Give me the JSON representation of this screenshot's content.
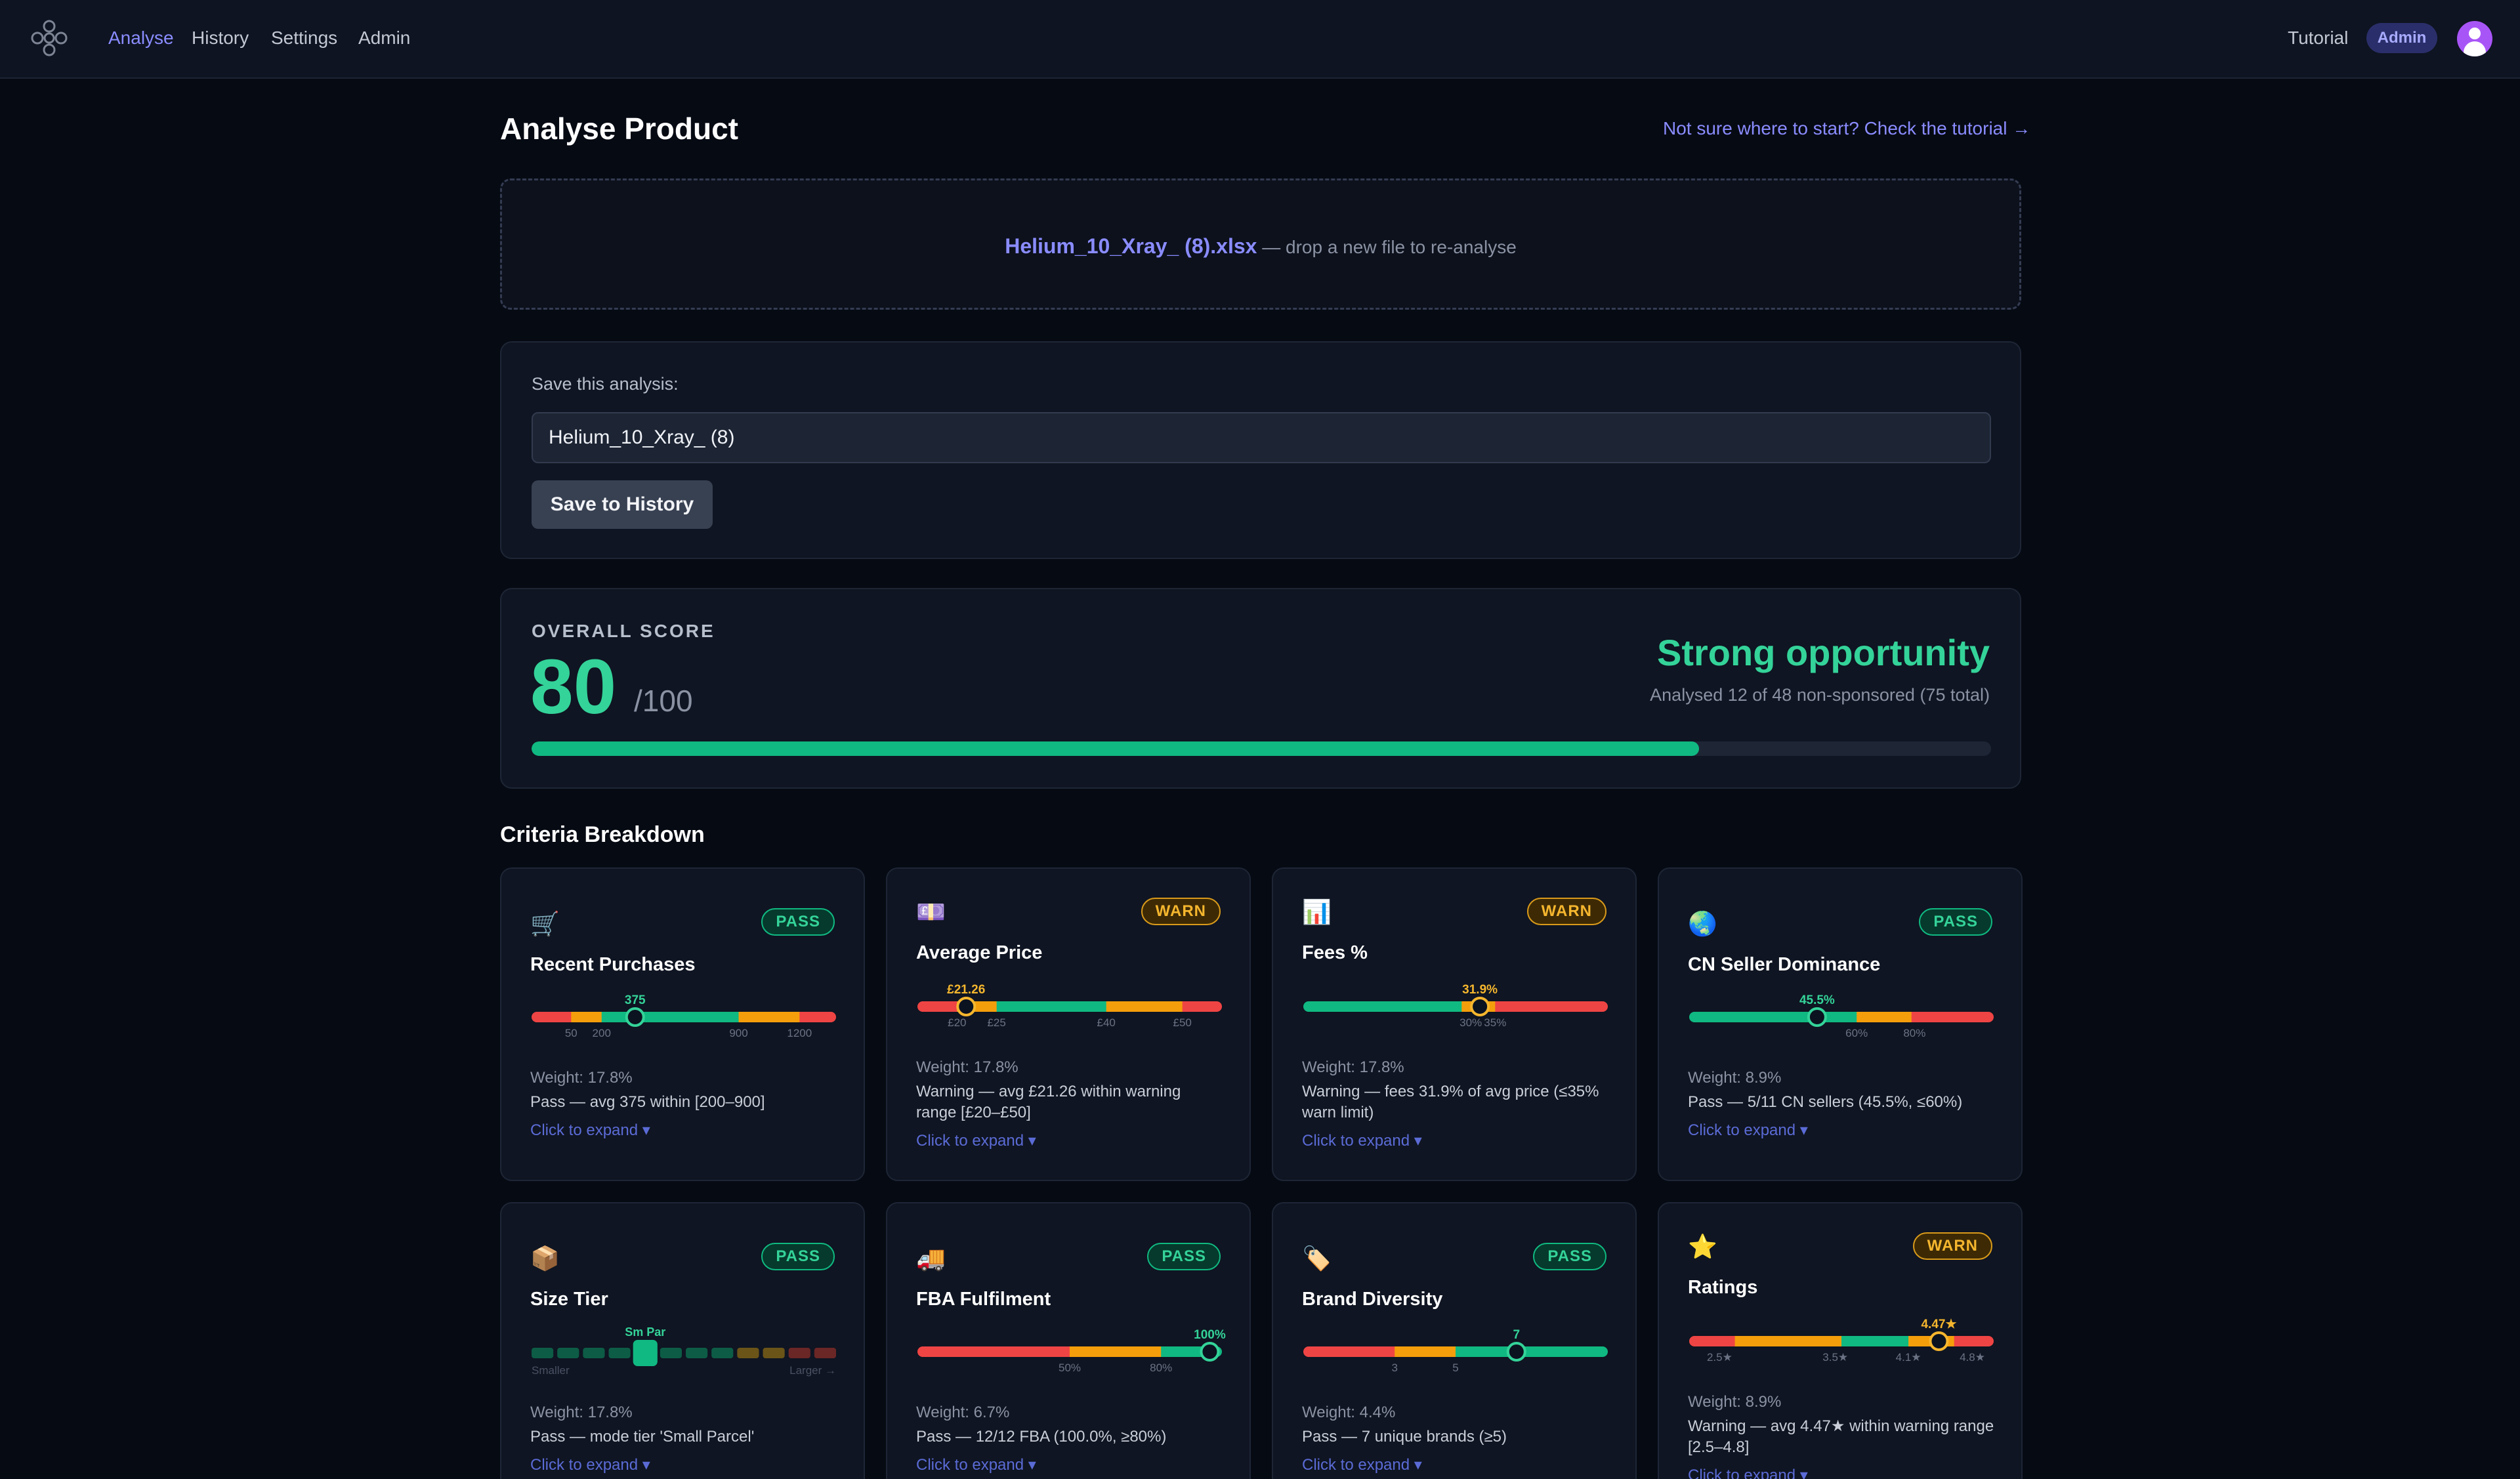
{
  "nav": {
    "links": [
      "Analyse",
      "History",
      "Settings",
      "Admin"
    ],
    "tutorial": "Tutorial",
    "admin_badge": "Admin"
  },
  "page": {
    "title": "Analyse Product",
    "tutorial_cta": "Not sure where to start? Check the tutorial →"
  },
  "dropzone": {
    "filename": "Helium_10_Xray_ (8).xlsx",
    "hint": " — drop a new file to re-analyse"
  },
  "save": {
    "label": "Save this analysis:",
    "input_value": "Helium_10_Xray_ (8)",
    "button": "Save to History"
  },
  "score": {
    "caption": "OVERALL SCORE",
    "value": "80",
    "max": "/100",
    "progress": 0.8,
    "verdict": "Strong opportunity",
    "analysed": "Analysed 12 of 48 non-sponsored (75 total)"
  },
  "criteria": {
    "title": "Criteria Breakdown",
    "cards": [
      {
        "icon": "🛒",
        "icon_name": "cart-icon",
        "title": "Recent Purchases",
        "badge": "PASS",
        "value_label": "375",
        "pointer": 0.34,
        "segments": [
          [
            "#ef4444",
            0.13
          ],
          [
            "#f59e0b",
            0.1
          ],
          [
            "#10b981",
            0.45
          ],
          [
            "#f59e0b",
            0.2
          ],
          [
            "#ef4444",
            0.12
          ]
        ],
        "ticks": [
          [
            "50",
            0.13
          ],
          [
            "200",
            0.23
          ],
          [
            "900",
            0.68
          ],
          [
            "1200",
            0.88
          ]
        ],
        "weight": "Weight: 17.8%",
        "desc": "Pass — avg 375 within [200–900]",
        "expand": "Click to expand ▾"
      },
      {
        "icon": "💷",
        "icon_name": "money-icon",
        "title": "Average Price",
        "badge": "WARN",
        "value_label": "£21.26",
        "pointer": 0.16,
        "segments": [
          [
            "#ef4444",
            0.13
          ],
          [
            "#f59e0b",
            0.13
          ],
          [
            "#10b981",
            0.36
          ],
          [
            "#f59e0b",
            0.25
          ],
          [
            "#ef4444",
            0.13
          ]
        ],
        "ticks": [
          [
            "£20",
            0.13
          ],
          [
            "£25",
            0.26
          ],
          [
            "£40",
            0.62
          ],
          [
            "£50",
            0.87
          ]
        ],
        "weight": "Weight: 17.8%",
        "desc": "Warning — avg £21.26 within warning range [£20–£50]",
        "expand": "Click to expand ▾"
      },
      {
        "icon": "📊",
        "icon_name": "bar-chart-icon",
        "title": "Fees %",
        "badge": "WARN",
        "value_label": "31.9%",
        "pointer": 0.58,
        "segments": [
          [
            "#10b981",
            0.52
          ],
          [
            "#f59e0b",
            0.11
          ],
          [
            "#ef4444",
            0.37
          ]
        ],
        "ticks": [
          [
            "30%",
            0.55
          ],
          [
            "35%",
            0.63
          ]
        ],
        "weight": "Weight: 17.8%",
        "desc": "Warning — fees 31.9% of avg price (≤35% warn limit)",
        "expand": "Click to expand ▾"
      },
      {
        "icon": "🌏",
        "icon_name": "globe-icon",
        "title": "CN Seller Dominance",
        "badge": "PASS",
        "value_label": "45.5%",
        "pointer": 0.42,
        "segments": [
          [
            "#10b981",
            0.55
          ],
          [
            "#f59e0b",
            0.18
          ],
          [
            "#ef4444",
            0.27
          ]
        ],
        "ticks": [
          [
            "60%",
            0.55
          ],
          [
            "80%",
            0.74
          ]
        ],
        "weight": "Weight: 8.9%",
        "desc": "Pass — 5/11 CN sellers (45.5%, ≤60%)",
        "expand": "Click to expand ▾"
      },
      {
        "icon": "📦",
        "icon_name": "package-icon",
        "title": "Size Tier",
        "badge": "PASS",
        "value_label": "Sm Par",
        "pointer": 0.375,
        "tier_colors": [
          "#0d5c46",
          "#0d5c46",
          "#0d5c46",
          "#0d5c46",
          "#10b981",
          "#0d5c46",
          "#0d5c46",
          "#0d5c46",
          "#6b5418",
          "#6b5418",
          "#6b2626",
          "#6b2626"
        ],
        "active_tier": 4,
        "tier_left": "Smaller",
        "tier_right": "Larger →",
        "weight": "Weight: 17.8%",
        "desc": "Pass — mode tier 'Small Parcel'",
        "expand": "Click to expand ▾"
      },
      {
        "icon": "🚚",
        "icon_name": "truck-icon",
        "title": "FBA Fulfilment",
        "badge": "PASS",
        "value_label": "100%",
        "pointer": 0.96,
        "segments": [
          [
            "#ef4444",
            0.5
          ],
          [
            "#f59e0b",
            0.3
          ],
          [
            "#10b981",
            0.2
          ]
        ],
        "ticks": [
          [
            "50%",
            0.5
          ],
          [
            "80%",
            0.8
          ]
        ],
        "weight": "Weight: 6.7%",
        "desc": "Pass — 12/12 FBA (100.0%, ≥80%)",
        "expand": "Click to expand ▾"
      },
      {
        "icon": "🏷️",
        "icon_name": "tag-icon",
        "title": "Brand Diversity",
        "badge": "PASS",
        "value_label": "7",
        "pointer": 0.7,
        "segments": [
          [
            "#ef4444",
            0.3
          ],
          [
            "#f59e0b",
            0.2
          ],
          [
            "#10b981",
            0.5
          ]
        ],
        "ticks": [
          [
            "3",
            0.3
          ],
          [
            "5",
            0.5
          ]
        ],
        "weight": "Weight: 4.4%",
        "desc": "Pass — 7 unique brands (≥5)",
        "expand": "Click to expand ▾"
      },
      {
        "icon": "⭐",
        "icon_name": "star-icon",
        "title": "Ratings",
        "badge": "WARN",
        "value_label": "4.47★",
        "pointer": 0.82,
        "segments": [
          [
            "#ef4444",
            0.15
          ],
          [
            "#f59e0b",
            0.35
          ],
          [
            "#10b981",
            0.22
          ],
          [
            "#f59e0b",
            0.15
          ],
          [
            "#ef4444",
            0.13
          ]
        ],
        "ticks": [
          [
            "2.5★",
            0.1
          ],
          [
            "3.5★",
            0.48
          ],
          [
            "4.1★",
            0.72
          ],
          [
            "4.8★",
            0.93
          ]
        ],
        "weight": "Weight: 8.9%",
        "desc": "Warning — avg 4.47★ within warning range [2.5–4.8]",
        "expand": "Click to expand ▾"
      }
    ]
  }
}
